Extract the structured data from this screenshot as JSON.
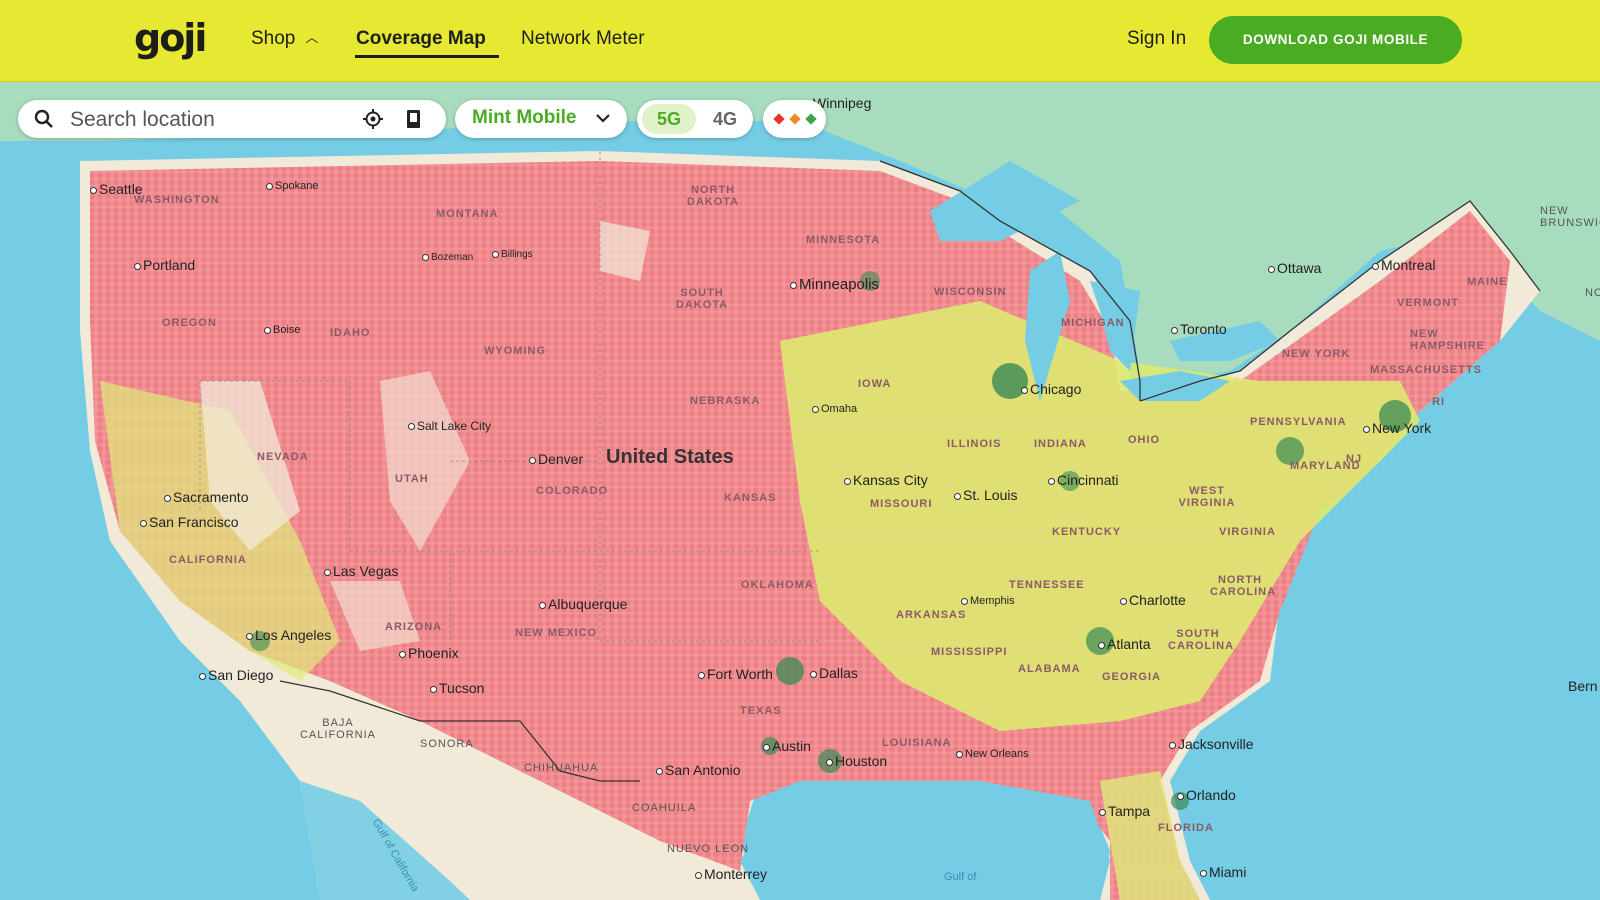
{
  "header": {
    "logo": "goji",
    "nav": [
      {
        "label": "Shop"
      },
      {
        "label": "Coverage Map"
      },
      {
        "label": "Network Meter"
      }
    ],
    "sign_in": "Sign In",
    "download_button": "DOWNLOAD GOJI MOBILE"
  },
  "search": {
    "placeholder": "Search location",
    "icon": "search-icon",
    "locate_icon": "crosshair-icon",
    "book_icon": "book-icon"
  },
  "carrier": {
    "selected": "Mint Mobile"
  },
  "network": {
    "selected": "5G",
    "options": [
      "5G",
      "4G"
    ]
  },
  "legend": {
    "colors": [
      "#e8332a",
      "#f08a24",
      "#3fa34d"
    ]
  },
  "map": {
    "country_label": "United States",
    "cities": [
      "Winnipeg",
      "Seattle",
      "Spokane",
      "Portland",
      "Boise",
      "Bozeman",
      "Billings",
      "Minneapolis",
      "Ottawa",
      "Montreal",
      "Toronto",
      "Chicago",
      "Salt Lake City",
      "Denver",
      "Omaha",
      "Kansas City",
      "St. Louis",
      "Cincinnati",
      "New York",
      "Sacramento",
      "San Francisco",
      "Las Vegas",
      "Albuquerque",
      "Los Angeles",
      "Phoenix",
      "San Diego",
      "Tucson",
      "Memphis",
      "Charlotte",
      "Atlanta",
      "Fort Worth",
      "Dallas",
      "Austin",
      "Houston",
      "San Antonio",
      "New Orleans",
      "Jacksonville",
      "Orlando",
      "Tampa",
      "Miami",
      "Monterrey",
      "Bern"
    ],
    "states": [
      "WASHINGTON",
      "MONTANA",
      "NORTH DAKOTA",
      "MINNESOTA",
      "OREGON",
      "IDAHO",
      "SOUTH DAKOTA",
      "WYOMING",
      "WISCONSIN",
      "MICHIGAN",
      "NEW YORK",
      "VERMONT",
      "NEW HAMPSHIRE",
      "MAINE",
      "MASSACHUSETTS",
      "RI",
      "NEVADA",
      "UTAH",
      "COLORADO",
      "NEBRASKA",
      "IOWA",
      "ILLINOIS",
      "INDIANA",
      "OHIO",
      "PENNSYLVANIA",
      "NJ",
      "MARYLAND",
      "WEST VIRGINIA",
      "VIRGINIA",
      "KENTUCKY",
      "KANSAS",
      "MISSOURI",
      "CALIFORNIA",
      "ARIZONA",
      "NEW MEXICO",
      "OKLAHOMA",
      "ARKANSAS",
      "TENNESSEE",
      "NORTH CAROLINA",
      "SOUTH CAROLINA",
      "MISSISSIPPI",
      "ALABAMA",
      "GEORGIA",
      "TEXAS",
      "LOUISIANA",
      "FLORIDA"
    ],
    "regions": [
      "NEW BRUNSWICK",
      "NO",
      "BAJA CALIFORNIA",
      "SONORA",
      "CHIHUAHUA",
      "COAHUILA",
      "NUEVO LEON"
    ],
    "water": [
      "Gulf of California",
      "Gulf of"
    ]
  }
}
